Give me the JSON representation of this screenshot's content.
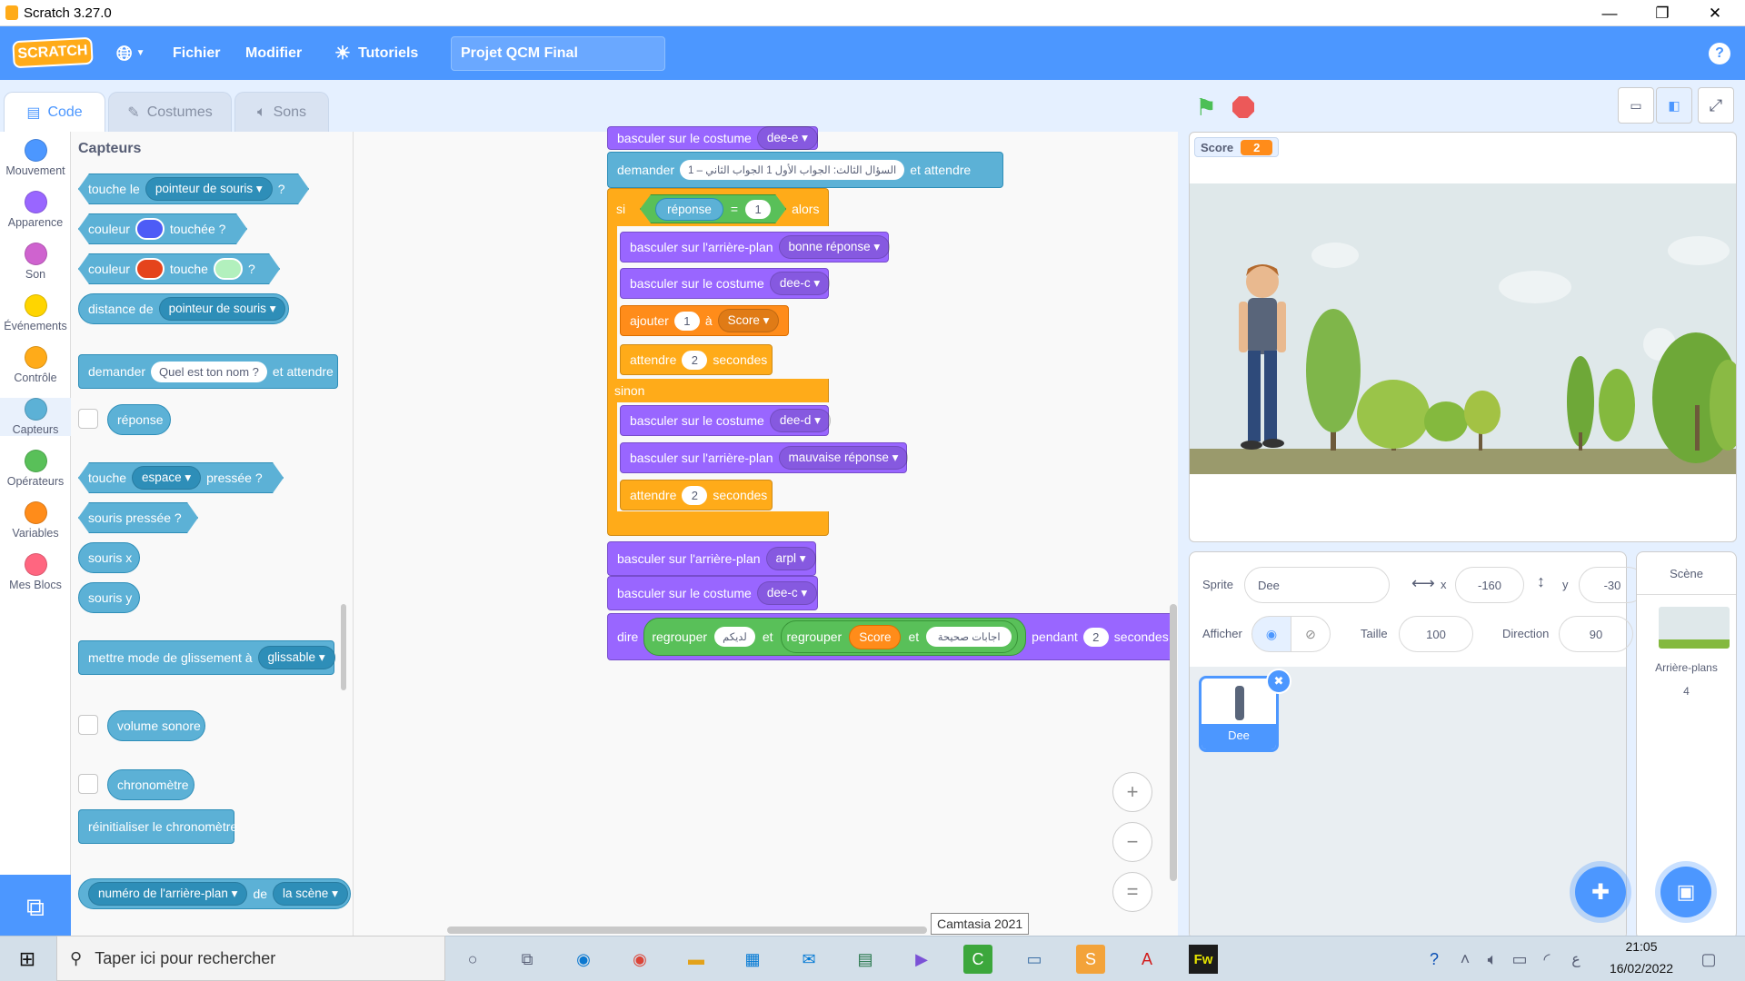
{
  "window": {
    "title": "Scratch 3.27.0",
    "min": "—",
    "max": "❐",
    "close": "✕"
  },
  "menu": {
    "logo": "SCRATCH",
    "file": "Fichier",
    "edit": "Modifier",
    "tutorials": "Tutoriels",
    "project_title": "Projet QCM Final",
    "help": "?"
  },
  "tabs": [
    {
      "label": "Code"
    },
    {
      "label": "Costumes"
    },
    {
      "label": "Sons"
    }
  ],
  "categories": [
    {
      "label": "Mouvement",
      "color": "#4c97ff"
    },
    {
      "label": "Apparence",
      "color": "#9966ff"
    },
    {
      "label": "Son",
      "color": "#cf63cf"
    },
    {
      "label": "Événements",
      "color": "#ffd500"
    },
    {
      "label": "Contrôle",
      "color": "#ffab19"
    },
    {
      "label": "Capteurs",
      "color": "#5cb1d6"
    },
    {
      "label": "Opérateurs",
      "color": "#59c059"
    },
    {
      "label": "Variables",
      "color": "#ff8c1a"
    },
    {
      "label": "Mes Blocs",
      "color": "#ff6680"
    }
  ],
  "palette": {
    "heading": "Capteurs",
    "touching": {
      "a": "touche le",
      "dd": "pointeur de souris",
      "b": "?"
    },
    "touching_color": {
      "a": "couleur",
      "b": "touchée ?",
      "swatch": "#4d5cf6"
    },
    "color_touching": {
      "a": "couleur",
      "b": "touche",
      "c": "?",
      "swatch1": "#e5441c",
      "swatch2": "#b2f0bd"
    },
    "distance": {
      "a": "distance de",
      "dd": "pointeur de souris"
    },
    "ask": {
      "a": "demander",
      "input": "Quel est ton nom ?",
      "b": "et attendre"
    },
    "answer": "réponse",
    "key": {
      "a": "touche",
      "dd": "espace",
      "b": "pressée ?"
    },
    "mouse_down": "souris pressée ?",
    "mouse_x": "souris x",
    "mouse_y": "souris y",
    "drag": {
      "a": "mettre mode de glissement à",
      "dd": "glissable"
    },
    "loudness": "volume sonore",
    "timer": "chronomètre",
    "reset_timer": "réinitialiser le chronomètre",
    "backdrop_of": {
      "dd1": "numéro de l'arrière-plan",
      "a": "de",
      "dd2": "la scène"
    }
  },
  "script": {
    "b0": {
      "a": "basculer sur le costume",
      "dd": "dee-e"
    },
    "b1": {
      "a": "demander",
      "input": "السؤال الثالث: الجواب الأول 1 الجواب الثاني – 1",
      "b": "et attendre"
    },
    "if": {
      "si": "si",
      "var": "réponse",
      "eq": "=",
      "val": "1",
      "alors": "alors"
    },
    "b2": {
      "a": "basculer sur l'arrière-plan",
      "dd": "bonne réponse"
    },
    "b3": {
      "a": "basculer sur le costume",
      "dd": "dee-c"
    },
    "b4": {
      "a": "ajouter",
      "val": "1",
      "b": "à",
      "dd": "Score"
    },
    "b5": {
      "a": "attendre",
      "val": "2",
      "b": "secondes"
    },
    "sinon": "sinon",
    "b6": {
      "a": "basculer sur le costume",
      "dd": "dee-d"
    },
    "b7": {
      "a": "basculer sur l'arrière-plan",
      "dd": "mauvaise réponse"
    },
    "b8": {
      "a": "attendre",
      "val": "2",
      "b": "secondes"
    },
    "b9": {
      "a": "basculer sur l'arrière-plan",
      "dd": "arpl"
    },
    "b10": {
      "a": "basculer sur le costume",
      "dd": "dee-c"
    },
    "b11": {
      "a": "dire",
      "j1": "regrouper",
      "s1": "لديكم",
      "et1": "et",
      "j2": "regrouper",
      "s2": "Score",
      "et2": "et",
      "s3": "اجابات صحيحة",
      "b": "pendant",
      "val": "2",
      "c": "secondes"
    }
  },
  "zoom": {
    "in": "+",
    "out": "−",
    "reset": "="
  },
  "stage": {
    "monitor_label": "Score",
    "monitor_value": "2"
  },
  "sprite": {
    "label_sprite": "Sprite",
    "name": "Dee",
    "x_label": "x",
    "x": "-160",
    "y_label": "y",
    "y": "-30",
    "show_label": "Afficher",
    "size_label": "Taille",
    "size": "100",
    "dir_label": "Direction",
    "dir": "90",
    "thumb_name": "Dee"
  },
  "stage_pane": {
    "title": "Scène",
    "backdrops_label": "Arrière-plans",
    "backdrops_count": "4"
  },
  "tooltip": "Camtasia 2021",
  "taskbar": {
    "search": "Taper ici pour rechercher",
    "time": "21:05",
    "date": "16/02/2022",
    "lang": "ع"
  }
}
